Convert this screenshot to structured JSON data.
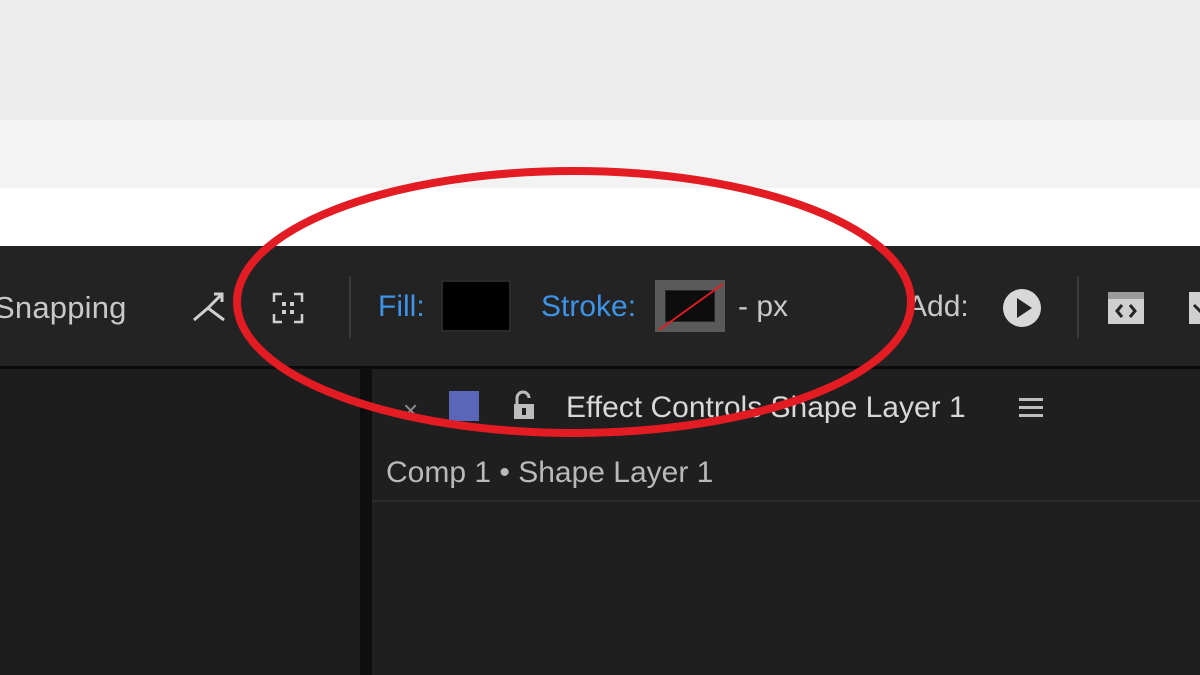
{
  "toolbar": {
    "snapping_label": "Snapping",
    "fill_label": "Fill:",
    "fill_color": "#000000",
    "stroke_label": "Stroke:",
    "stroke_width": "- px",
    "add_label": "Add:",
    "icons": [
      "snap-arrow-icon",
      "selection-icon",
      "play-icon",
      "tool-icon",
      "tool-icon"
    ]
  },
  "effect_controls": {
    "close_label": "×",
    "label_color": "#5a67b8",
    "title": "Effect Controls Shape Layer 1",
    "comp_path": "Comp 1 • Shape Layer 1"
  },
  "colors": {
    "accent_blue": "#3d93e8",
    "annotation_red": "#e31b23"
  }
}
